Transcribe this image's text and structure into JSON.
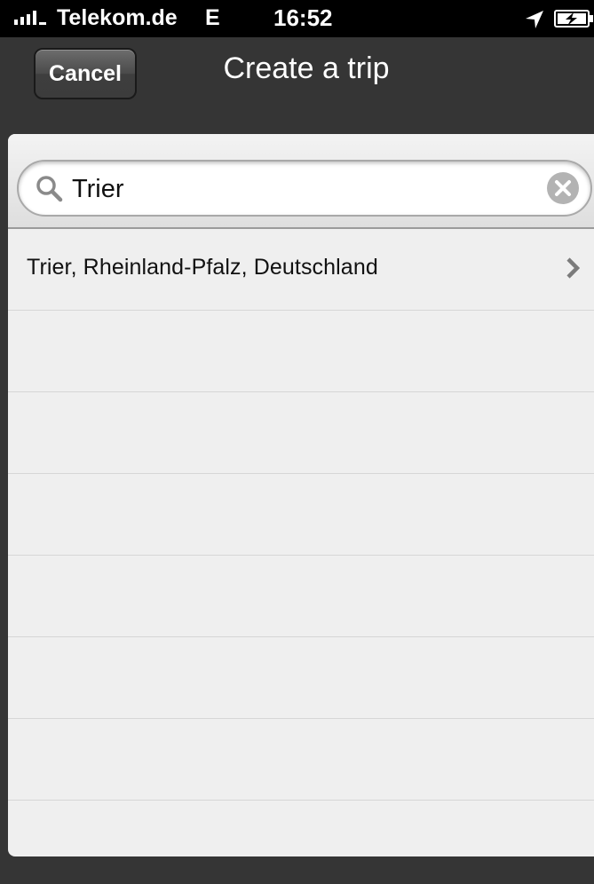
{
  "status_bar": {
    "carrier": "Telekom.de",
    "network": "E",
    "time": "16:52",
    "icons": [
      "signal-icon",
      "location-icon",
      "battery-charging-icon"
    ]
  },
  "nav": {
    "cancel_label": "Cancel",
    "title": "Create a trip"
  },
  "search": {
    "value": "Trier",
    "icons": [
      "search-icon",
      "clear-icon"
    ]
  },
  "results": [
    {
      "label": "Trier, Rheinland-Pfalz, Deutschland",
      "icon": "chevron-right-icon"
    },
    {
      "label": ""
    },
    {
      "label": ""
    },
    {
      "label": ""
    },
    {
      "label": ""
    },
    {
      "label": ""
    },
    {
      "label": ""
    },
    {
      "label": ""
    }
  ],
  "colors": {
    "status_bar_bg": "#000000",
    "nav_bg": "#353535",
    "list_bg": "#efefef",
    "separator": "#d6d6d6"
  }
}
